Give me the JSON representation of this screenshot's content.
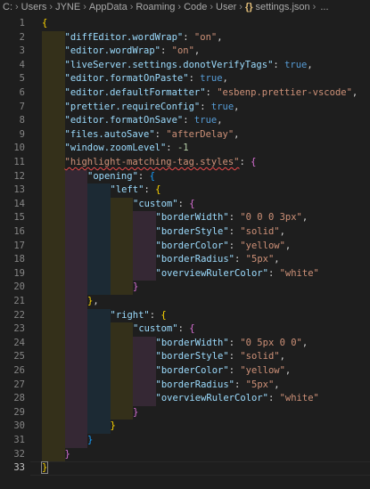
{
  "breadcrumb": {
    "drive": "C:",
    "parts": [
      "Users",
      "JYNE",
      "AppData",
      "Roaming",
      "Code",
      "User"
    ],
    "file_icon": "{}",
    "file": "settings.json",
    "ellipsis": "..."
  },
  "colors": {
    "background": "#1e1e1e",
    "key": "#9cdcfe",
    "string": "#ce9178",
    "boolean": "#569cd6",
    "number": "#b5cea8",
    "bracket_gold": "#ffd700",
    "bracket_magenta": "#da70d6",
    "bracket_blue": "#179fff",
    "error_squiggle": "#f14c4c"
  },
  "editor": {
    "active_line": 33,
    "lines": [
      [
        {
          "t": "{",
          "c": "y"
        }
      ],
      [
        {
          "t": "\"diffEditor.wordWrap\"",
          "c": "k"
        },
        {
          "t": ": ",
          "c": "p"
        },
        {
          "t": "\"on\"",
          "c": "s"
        },
        {
          "t": ",",
          "c": "p"
        }
      ],
      [
        {
          "t": "\"editor.wordWrap\"",
          "c": "k"
        },
        {
          "t": ": ",
          "c": "p"
        },
        {
          "t": "\"on\"",
          "c": "s"
        },
        {
          "t": ",",
          "c": "p"
        }
      ],
      [
        {
          "t": "\"liveServer.settings.donotVerifyTags\"",
          "c": "k"
        },
        {
          "t": ": ",
          "c": "p"
        },
        {
          "t": "true",
          "c": "b"
        },
        {
          "t": ",",
          "c": "p"
        }
      ],
      [
        {
          "t": "\"editor.formatOnPaste\"",
          "c": "k"
        },
        {
          "t": ": ",
          "c": "p"
        },
        {
          "t": "true",
          "c": "b"
        },
        {
          "t": ",",
          "c": "p"
        }
      ],
      [
        {
          "t": "\"editor.defaultFormatter\"",
          "c": "k"
        },
        {
          "t": ": ",
          "c": "p"
        },
        {
          "t": "\"esbenp.prettier-vscode\"",
          "c": "s"
        },
        {
          "t": ",",
          "c": "p"
        }
      ],
      [
        {
          "t": "\"prettier.requireConfig\"",
          "c": "k"
        },
        {
          "t": ": ",
          "c": "p"
        },
        {
          "t": "true",
          "c": "b"
        },
        {
          "t": ",",
          "c": "p"
        }
      ],
      [
        {
          "t": "\"editor.formatOnSave\"",
          "c": "k"
        },
        {
          "t": ": ",
          "c": "p"
        },
        {
          "t": "true",
          "c": "b"
        },
        {
          "t": ",",
          "c": "p"
        }
      ],
      [
        {
          "t": "\"files.autoSave\"",
          "c": "k"
        },
        {
          "t": ": ",
          "c": "p"
        },
        {
          "t": "\"afterDelay\"",
          "c": "s"
        },
        {
          "t": ",",
          "c": "p"
        }
      ],
      [
        {
          "t": "\"window.zoomLevel\"",
          "c": "k"
        },
        {
          "t": ": ",
          "c": "p"
        },
        {
          "t": "-1",
          "c": "n"
        }
      ],
      [
        {
          "t": "\"highlight-matching-tag.styles\"",
          "c": "s",
          "sq": true
        },
        {
          "t": ": ",
          "c": "p"
        },
        {
          "t": "{",
          "c": "m"
        }
      ],
      [
        {
          "t": "\"opening\"",
          "c": "k"
        },
        {
          "t": ": ",
          "c": "p"
        },
        {
          "t": "{",
          "c": "c"
        }
      ],
      [
        {
          "t": "\"left\"",
          "c": "k"
        },
        {
          "t": ": ",
          "c": "p"
        },
        {
          "t": "{",
          "c": "y"
        }
      ],
      [
        {
          "t": "\"custom\"",
          "c": "k"
        },
        {
          "t": ": ",
          "c": "p"
        },
        {
          "t": "{",
          "c": "m"
        }
      ],
      [
        {
          "t": "\"borderWidth\"",
          "c": "k"
        },
        {
          "t": ": ",
          "c": "p"
        },
        {
          "t": "\"0 0 0 3px\"",
          "c": "s"
        },
        {
          "t": ",",
          "c": "p"
        }
      ],
      [
        {
          "t": "\"borderStyle\"",
          "c": "k"
        },
        {
          "t": ": ",
          "c": "p"
        },
        {
          "t": "\"solid\"",
          "c": "s"
        },
        {
          "t": ",",
          "c": "p"
        }
      ],
      [
        {
          "t": "\"borderColor\"",
          "c": "k"
        },
        {
          "t": ": ",
          "c": "p"
        },
        {
          "t": "\"yellow\"",
          "c": "s"
        },
        {
          "t": ",",
          "c": "p"
        }
      ],
      [
        {
          "t": "\"borderRadius\"",
          "c": "k"
        },
        {
          "t": ": ",
          "c": "p"
        },
        {
          "t": "\"5px\"",
          "c": "s"
        },
        {
          "t": ",",
          "c": "p"
        }
      ],
      [
        {
          "t": "\"overviewRulerColor\"",
          "c": "k"
        },
        {
          "t": ": ",
          "c": "p"
        },
        {
          "t": "\"white\"",
          "c": "s"
        }
      ],
      [
        {
          "t": "}",
          "c": "m"
        }
      ],
      [
        {
          "t": "}",
          "c": "y"
        },
        {
          "t": ",",
          "c": "p"
        }
      ],
      [
        {
          "t": "\"right\"",
          "c": "k"
        },
        {
          "t": ": ",
          "c": "p"
        },
        {
          "t": "{",
          "c": "y"
        }
      ],
      [
        {
          "t": "\"custom\"",
          "c": "k"
        },
        {
          "t": ": ",
          "c": "p"
        },
        {
          "t": "{",
          "c": "m"
        }
      ],
      [
        {
          "t": "\"borderWidth\"",
          "c": "k"
        },
        {
          "t": ": ",
          "c": "p"
        },
        {
          "t": "\"0 5px 0 0\"",
          "c": "s"
        },
        {
          "t": ",",
          "c": "p"
        }
      ],
      [
        {
          "t": "\"borderStyle\"",
          "c": "k"
        },
        {
          "t": ": ",
          "c": "p"
        },
        {
          "t": "\"solid\"",
          "c": "s"
        },
        {
          "t": ",",
          "c": "p"
        }
      ],
      [
        {
          "t": "\"borderColor\"",
          "c": "k"
        },
        {
          "t": ": ",
          "c": "p"
        },
        {
          "t": "\"yellow\"",
          "c": "s"
        },
        {
          "t": ",",
          "c": "p"
        }
      ],
      [
        {
          "t": "\"borderRadius\"",
          "c": "k"
        },
        {
          "t": ": ",
          "c": "p"
        },
        {
          "t": "\"5px\"",
          "c": "s"
        },
        {
          "t": ",",
          "c": "p"
        }
      ],
      [
        {
          "t": "\"overviewRulerColor\"",
          "c": "k"
        },
        {
          "t": ": ",
          "c": "p"
        },
        {
          "t": "\"white\"",
          "c": "s"
        }
      ],
      [
        {
          "t": "}",
          "c": "m"
        }
      ],
      [
        {
          "t": "}",
          "c": "y"
        }
      ],
      [
        {
          "t": "}",
          "c": "c"
        }
      ],
      [
        {
          "t": "}",
          "c": "m"
        }
      ],
      [
        {
          "t": "}",
          "c": "y",
          "cursor": true
        }
      ]
    ]
  }
}
